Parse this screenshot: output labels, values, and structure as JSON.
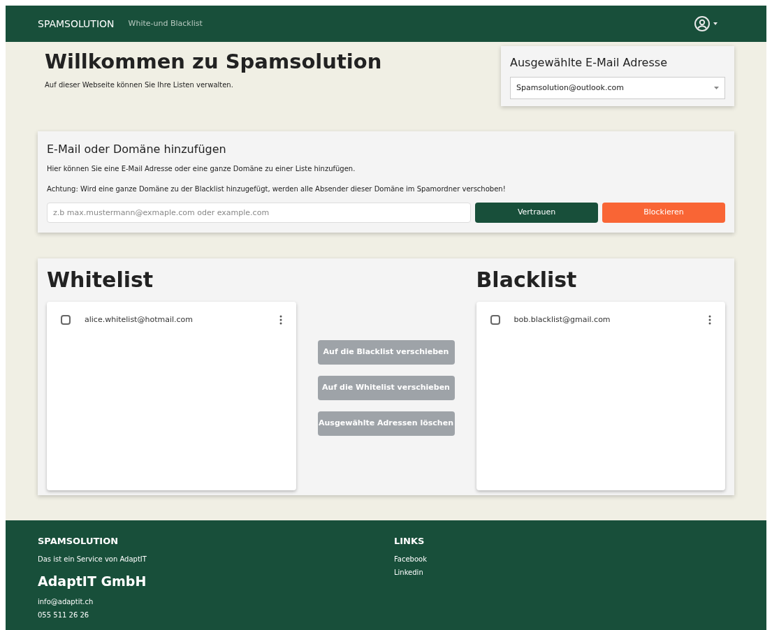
{
  "navbar": {
    "brand": "SPAMSOLUTION",
    "links": [
      {
        "label": "White-und Blacklist",
        "selected": false
      }
    ]
  },
  "header": {
    "title": "Willkommen zu Spamsolution",
    "subtitle": "Auf dieser Webseite können Sie Ihre Listen verwalten."
  },
  "email_select": {
    "title": "Ausgewählte E-Mail Adresse",
    "value": "Spamsolution@outlook.com"
  },
  "add_form": {
    "title": "E-Mail oder Domäne hinzufügen",
    "info": "Hier können Sie eine E-Mail Adresse oder eine ganze Domäne zu einer Liste hinzufügen.",
    "warning": "Achtung: Wird eine ganze Domäne zu der Blacklist hinzugefügt, werden alle Absender dieser Domäne im Spamordner verschoben!",
    "placeholder": "z.b max.mustermann@exmaple.com oder example.com",
    "buttons": [
      {
        "label": "Vertrauen",
        "kind": "trust"
      },
      {
        "label": "Blockieren",
        "kind": "block"
      }
    ]
  },
  "whitelist": {
    "title": "Whitelist",
    "items": [
      {
        "email": "alice.whitelist@hotmail.com",
        "checked": false
      }
    ]
  },
  "blacklist": {
    "title": "Blacklist",
    "items": [
      {
        "email": "bob.blacklist@gmail.com",
        "checked": false
      }
    ]
  },
  "actions": [
    {
      "label": "Auf die Blacklist verschieben",
      "disabled": true
    },
    {
      "label": "Auf die Whitelist verschieben",
      "disabled": true
    },
    {
      "label": "Ausgewählte Adressen löschen",
      "disabled": true
    }
  ],
  "footer": {
    "brand": "SPAMSOLUTION",
    "tagline": "Das ist ein Service von AdaptIT",
    "company": "AdaptIT GmbH",
    "email": "info@adaptit.ch",
    "phone": "055 511 26 26",
    "links_title": "LINKS",
    "links": [
      "Facebook",
      "Linkedin"
    ]
  }
}
